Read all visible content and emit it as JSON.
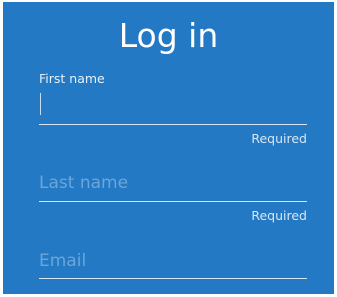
{
  "form": {
    "title": "Log in",
    "first_name": {
      "label": "First name",
      "value": "",
      "helper": "Required"
    },
    "last_name": {
      "placeholder": "Last name",
      "value": "",
      "helper": "Required"
    },
    "email": {
      "placeholder": "Email",
      "value": ""
    }
  },
  "colors": {
    "panel_background": "#2379c3",
    "text": "#ffffff",
    "placeholder": "#6aa6da",
    "underline": "#d8e6f4"
  }
}
